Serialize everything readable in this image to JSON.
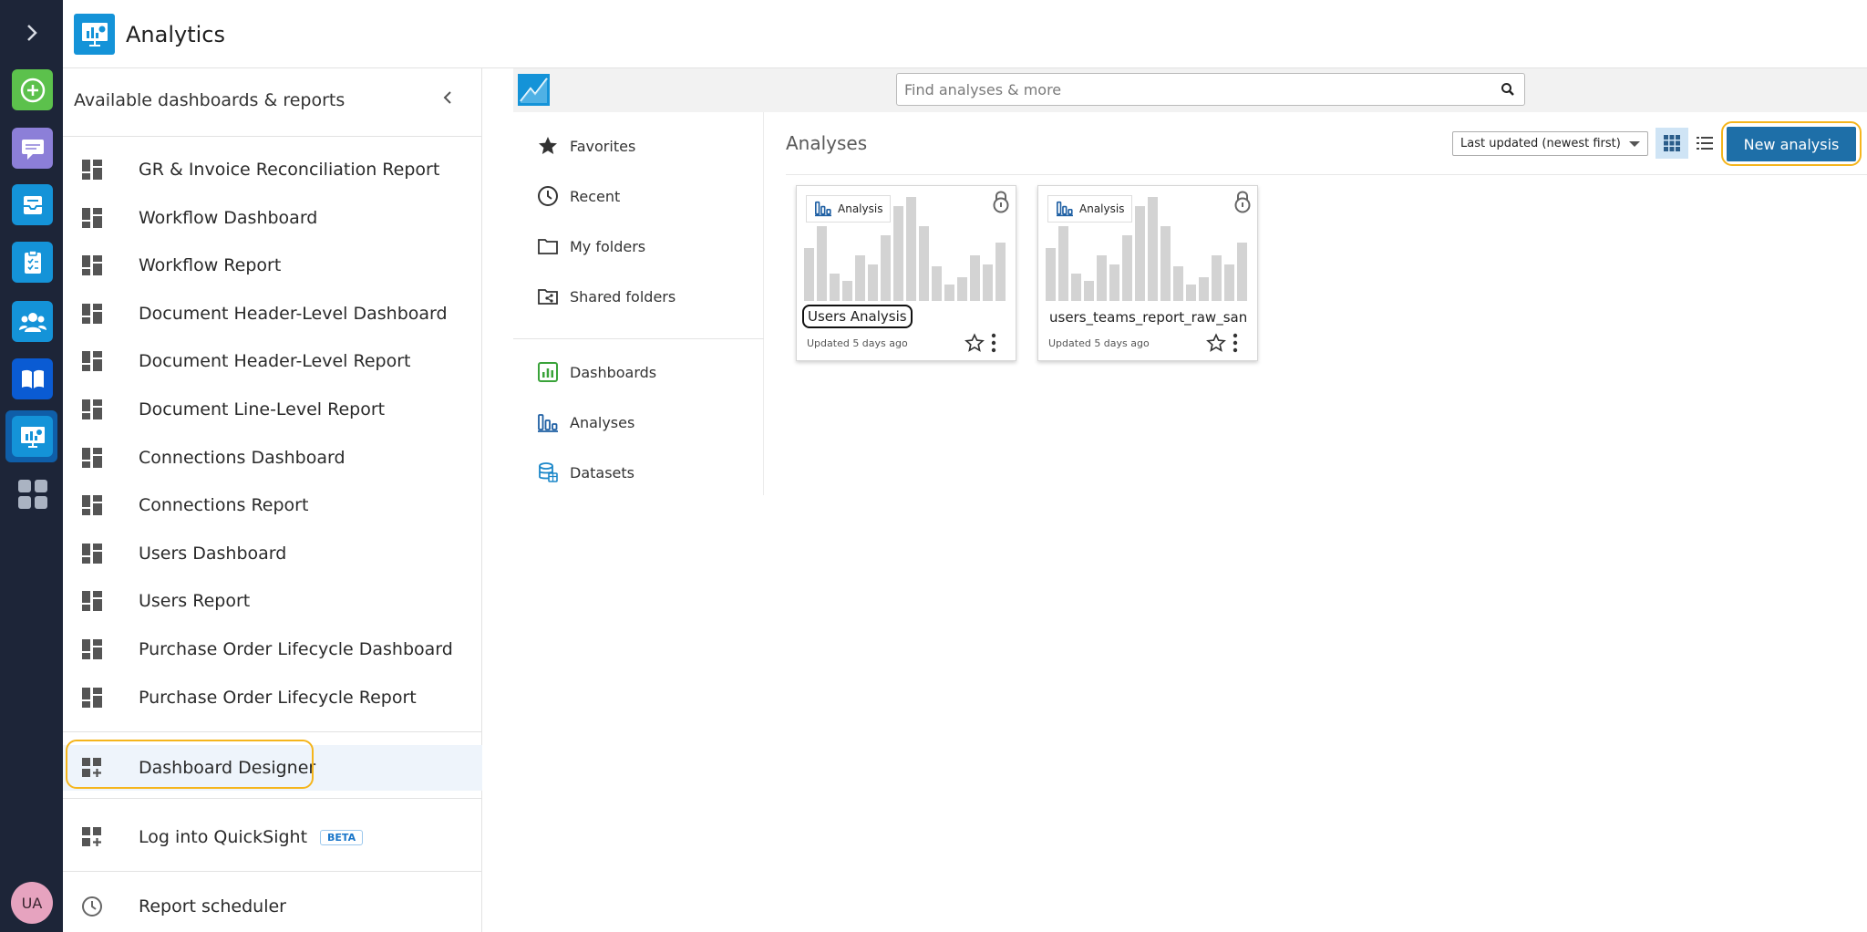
{
  "header": {
    "title": "Analytics"
  },
  "rail": {
    "icons": [
      "chevron-right-icon",
      "plus-circle-icon",
      "chat-icon",
      "inbox-icon",
      "clipboard-icon",
      "users-icon",
      "book-icon",
      "analytics-icon",
      "apps-grid-icon"
    ],
    "avatar": "UA",
    "colors": {
      "background": "#1d2538",
      "accent": "#1493d8"
    }
  },
  "panel": {
    "heading": "Available dashboards & reports",
    "items": [
      "GR & Invoice Reconciliation Report",
      "Workflow Dashboard",
      "Workflow Report",
      "Document Header-Level Dashboard",
      "Document Header-Level Report",
      "Document Line-Level Report",
      "Connections Dashboard",
      "Connections Report",
      "Users Dashboard",
      "Users Report",
      "Purchase Order Lifecycle Dashboard",
      "Purchase Order Lifecycle Report"
    ],
    "designer": "Dashboard Designer",
    "quicksight": "Log into QuickSight",
    "beta": "BETA",
    "scheduler": "Report scheduler"
  },
  "quicksight": {
    "search_placeholder": "Find analyses & more",
    "nav": {
      "favorites": "Favorites",
      "recent": "Recent",
      "my_folders": "My folders",
      "shared_folders": "Shared folders",
      "dashboards": "Dashboards",
      "analyses": "Analyses",
      "datasets": "Datasets"
    },
    "content_title": "Analyses",
    "sort_label": "Last updated (newest first)",
    "new_button": "New analysis",
    "cards": [
      {
        "badge": "Analysis",
        "name": "Users Analysis",
        "updated": "Updated 5 days ago"
      },
      {
        "badge": "Analysis",
        "name": "users_teams_report_raw_san",
        "updated": "Updated 5 days ago"
      }
    ],
    "colors": {
      "primary_button": "#1e6fa8",
      "highlight": "#f5b51c"
    }
  }
}
